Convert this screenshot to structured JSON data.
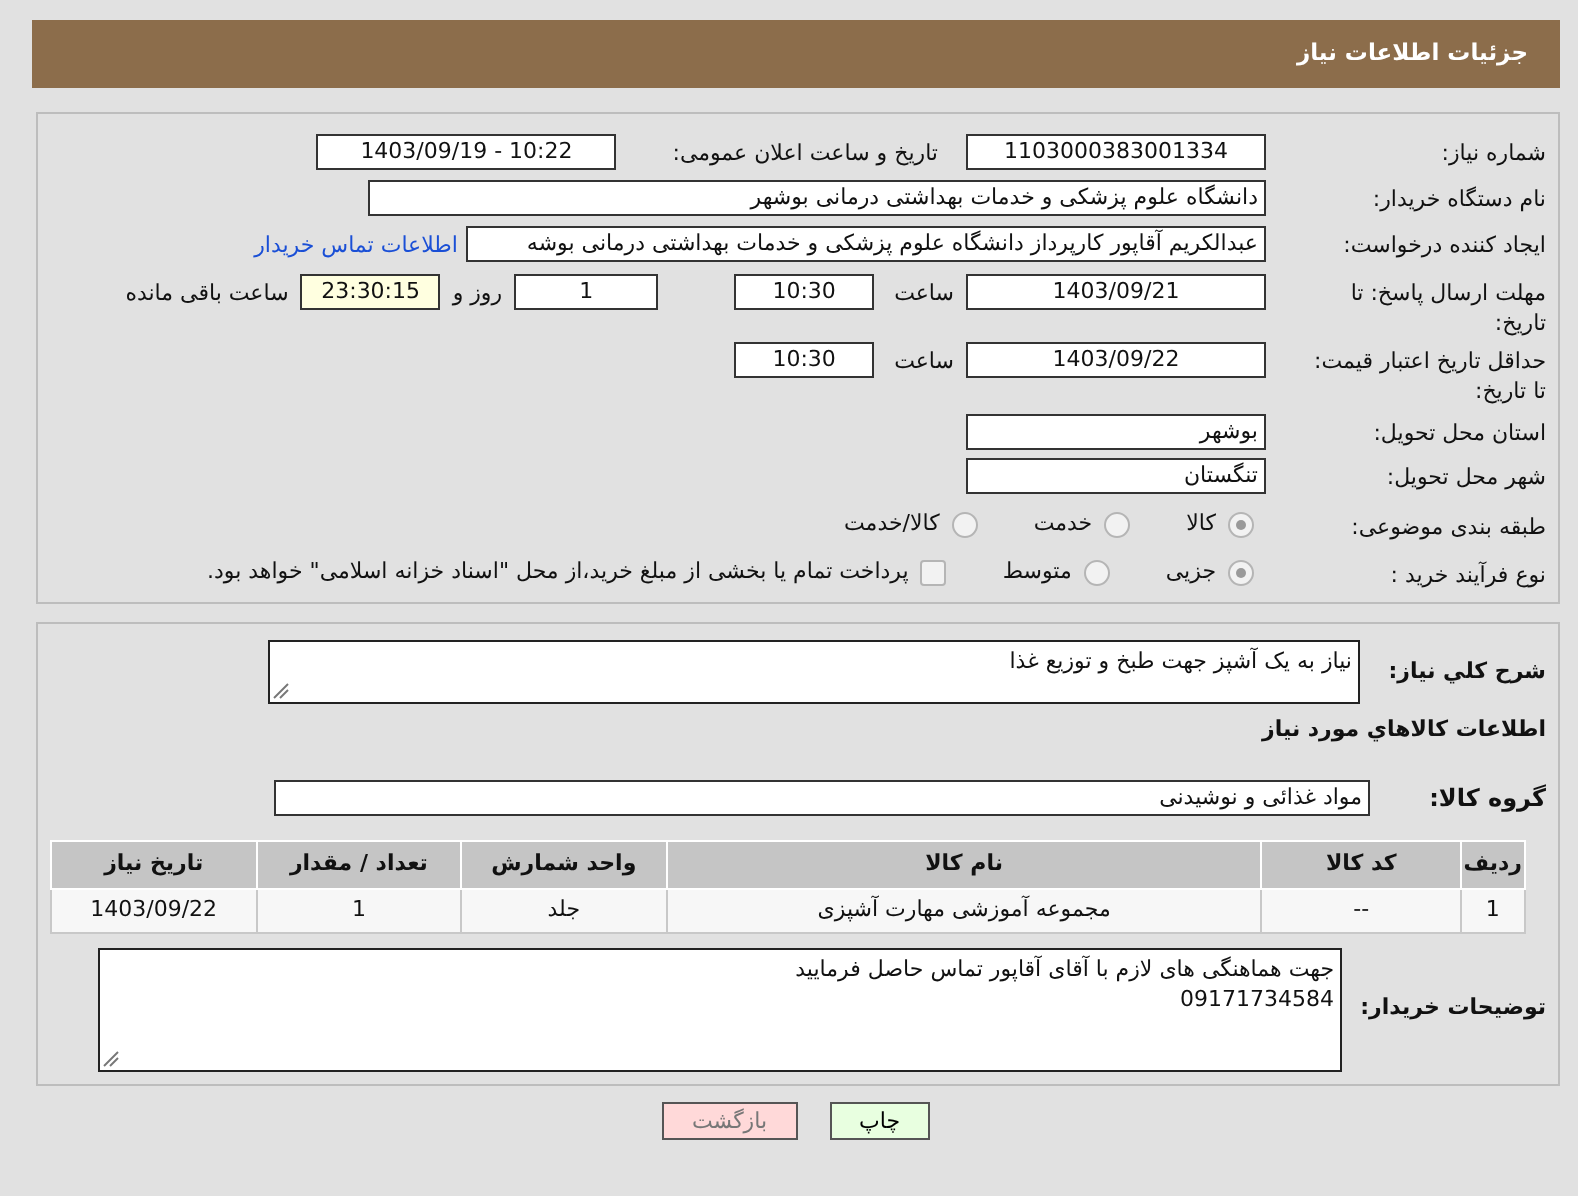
{
  "page_title": "جزئیات اطلاعات نیاز",
  "need_number": {
    "label": "شماره نیاز:",
    "value": "1103000383001334"
  },
  "announce": {
    "label": "تاریخ و ساعت اعلان عمومی:",
    "value": "1403/09/19 - 10:22"
  },
  "buyer_org": {
    "label": "نام دستگاه خریدار:",
    "value": "دانشگاه علوم پزشکی و خدمات بهداشتی درمانی بوشهر"
  },
  "requester": {
    "label": "ایجاد کننده درخواست:",
    "value": "عبدالکریم آقاپور کارپرداز دانشگاه علوم پزشکی و خدمات بهداشتی درمانی بوشه",
    "link": "اطلاعات تماس خریدار"
  },
  "reply_deadline": {
    "label": "مهلت ارسال پاسخ: تا تاریخ:",
    "date": "1403/09/21",
    "time_label": "ساعت",
    "time": "10:30",
    "days": "1",
    "days_label": "روز و",
    "remaining": "23:30:15",
    "remaining_label": "ساعت باقی مانده"
  },
  "price_validity": {
    "label": "حداقل تاریخ اعتبار قیمت: تا تاریخ:",
    "date": "1403/09/22",
    "time_label": "ساعت",
    "time": "10:30"
  },
  "province": {
    "label": "استان محل تحویل:",
    "value": "بوشهر"
  },
  "city": {
    "label": "شهر محل تحویل:",
    "value": "تنگستان"
  },
  "category": {
    "label": "طبقه بندی موضوعی:",
    "options": [
      {
        "label": "کالا",
        "selected": true
      },
      {
        "label": "خدمت",
        "selected": false
      },
      {
        "label": "کالا/خدمت",
        "selected": false
      }
    ]
  },
  "process": {
    "label": "نوع فرآیند خرید :",
    "options": [
      {
        "label": "جزیی",
        "selected": true
      },
      {
        "label": "متوسط",
        "selected": false
      }
    ],
    "treasury": {
      "checked": false,
      "text": "پرداخت تمام یا بخشی از مبلغ خرید،از محل \"اسناد خزانه اسلامی\" خواهد بود."
    }
  },
  "description": {
    "label": "شرح کلي نياز:",
    "value": "نیاز به یک آشپز جهت طبخ و توزیع غذا"
  },
  "items_heading": "اطلاعات کالاهاي مورد نياز",
  "goods_group": {
    "label": "گروه کالا:",
    "value": "مواد غذائی و نوشیدنی"
  },
  "table": {
    "columns": [
      "ردیف",
      "کد کالا",
      "نام کالا",
      "واحد شمارش",
      "تعداد / مقدار",
      "تاریخ نیاز"
    ],
    "rows": [
      [
        "1",
        "--",
        "مجموعه آموزشی مهارت آشپزی",
        "جلد",
        "1",
        "1403/09/22"
      ]
    ]
  },
  "buyer_notes": {
    "label": "توضیحات خریدار:",
    "lines": [
      "جهت هماهنگی های لازم با آقای آقاپور تماس حاصل فرمایید",
      "09171734584"
    ]
  },
  "buttons": [
    {
      "label": "چاپ",
      "kind": "print"
    },
    {
      "label": "بازگشت",
      "kind": "back"
    }
  ]
}
